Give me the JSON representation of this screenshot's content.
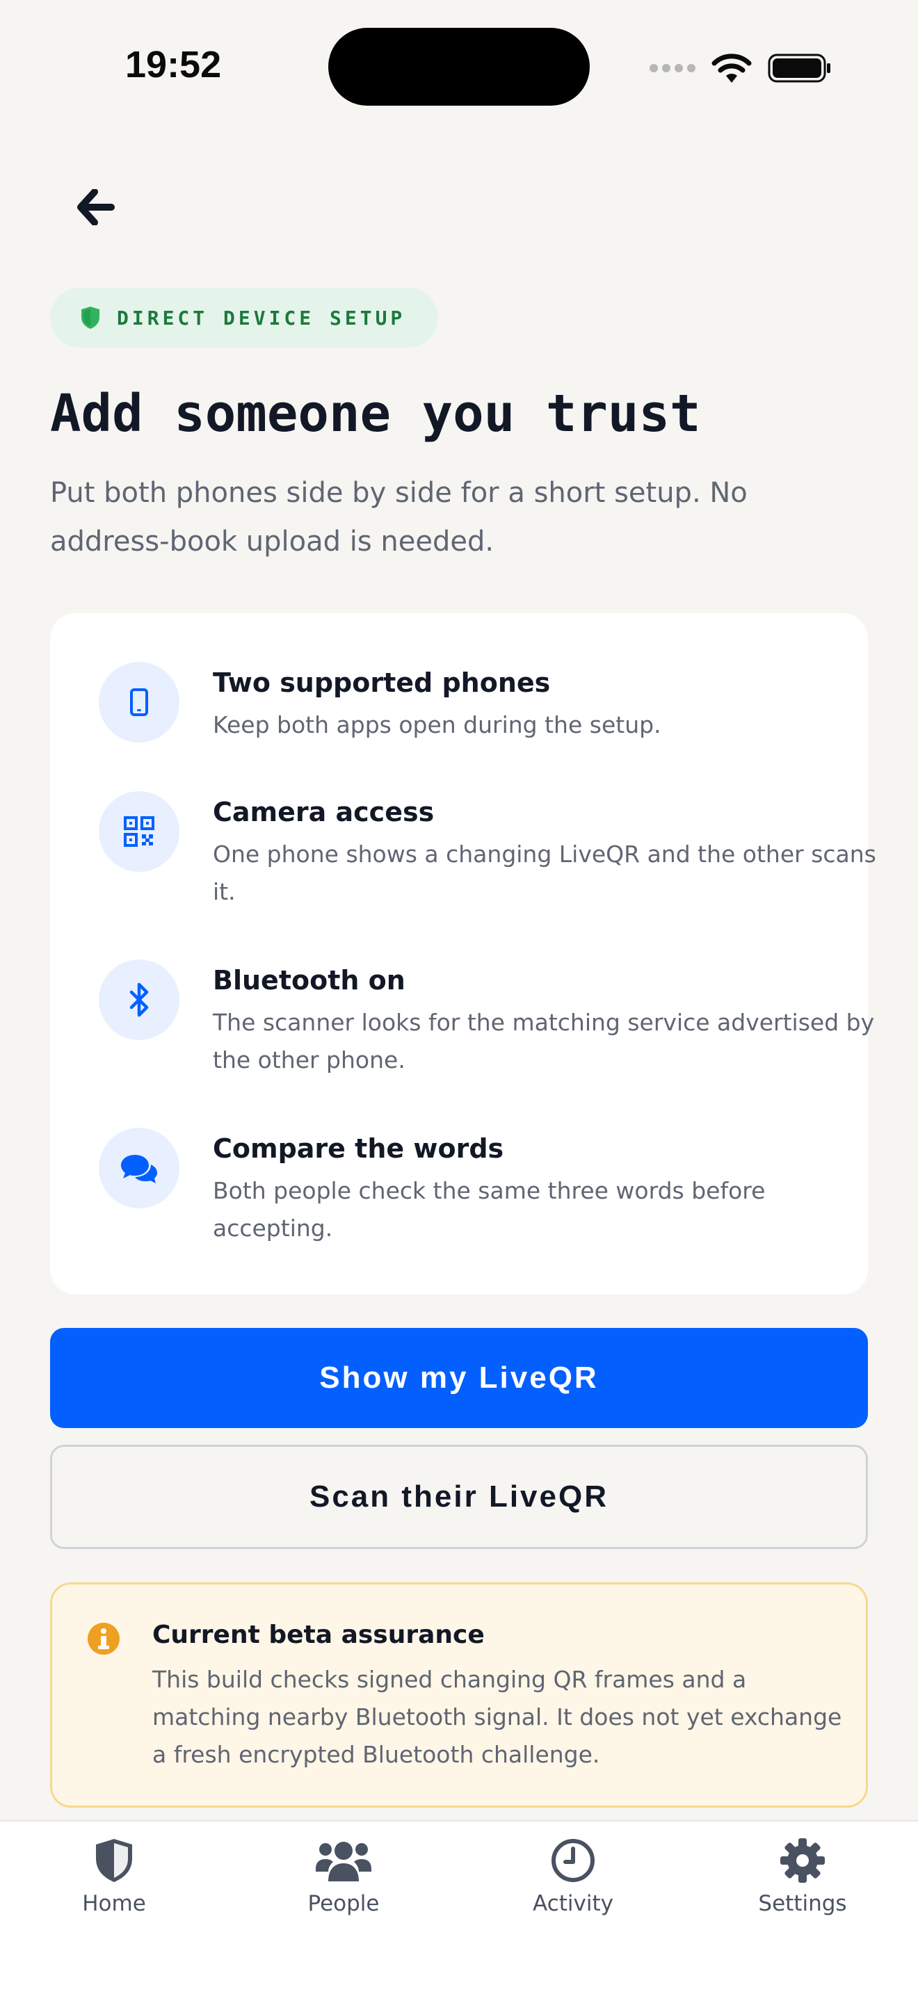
{
  "status_bar": {
    "time": "19:52"
  },
  "badge": {
    "label": "DIRECT DEVICE SETUP"
  },
  "page": {
    "title": "Add someone you trust",
    "subtitle": "Put both phones side by side for a short setup. No address-book upload is needed."
  },
  "requirements": [
    {
      "icon": "phone-icon",
      "title": "Two supported phones",
      "description": "Keep both apps open during the setup."
    },
    {
      "icon": "qr-code-icon",
      "title": "Camera access",
      "description": "One phone shows a changing LiveQR and the other scans it."
    },
    {
      "icon": "bluetooth-icon",
      "title": "Bluetooth on",
      "description": "The scanner looks for the matching service advertised by the other phone."
    },
    {
      "icon": "chat-bubbles-icon",
      "title": "Compare the words",
      "description": "Both people check the same three words before accepting."
    }
  ],
  "actions": {
    "primary": "Show my LiveQR",
    "secondary": "Scan their LiveQR"
  },
  "notice": {
    "title": "Current beta assurance",
    "body": "This build checks signed changing QR frames and a matching nearby Bluetooth signal. It does not yet exchange a fresh encrypted Bluetooth challenge."
  },
  "tabbar": [
    {
      "label": "Home",
      "icon": "shield-icon"
    },
    {
      "label": "People",
      "icon": "people-icon"
    },
    {
      "label": "Activity",
      "icon": "clock-icon"
    },
    {
      "label": "Settings",
      "icon": "gear-icon"
    }
  ],
  "colors": {
    "accent": "#0360ff",
    "badge_green": "#1b7a3c",
    "warning": "#f0a020"
  }
}
